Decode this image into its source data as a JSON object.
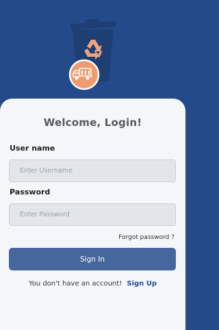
{
  "logo": {
    "icon": "recycle-bin-truck-icon",
    "colors": {
      "bin": "#1d3f74",
      "accent": "#f0a37c",
      "badge": "#ef9b6e"
    }
  },
  "login": {
    "title": "Welcome, Login!",
    "username_label": "User name",
    "username_placeholder": "Enter Username",
    "password_label": "Password",
    "password_placeholder": "Enter Password",
    "forgot_label": "Forgot password ?",
    "signin_label": "Sign In",
    "no_account_text": "You don't have an account!",
    "signup_label": "Sign Up"
  },
  "colors": {
    "header": "#254a8a",
    "card": "#f4f6fa",
    "button": "#46679d",
    "link": "#1f4f8f"
  }
}
